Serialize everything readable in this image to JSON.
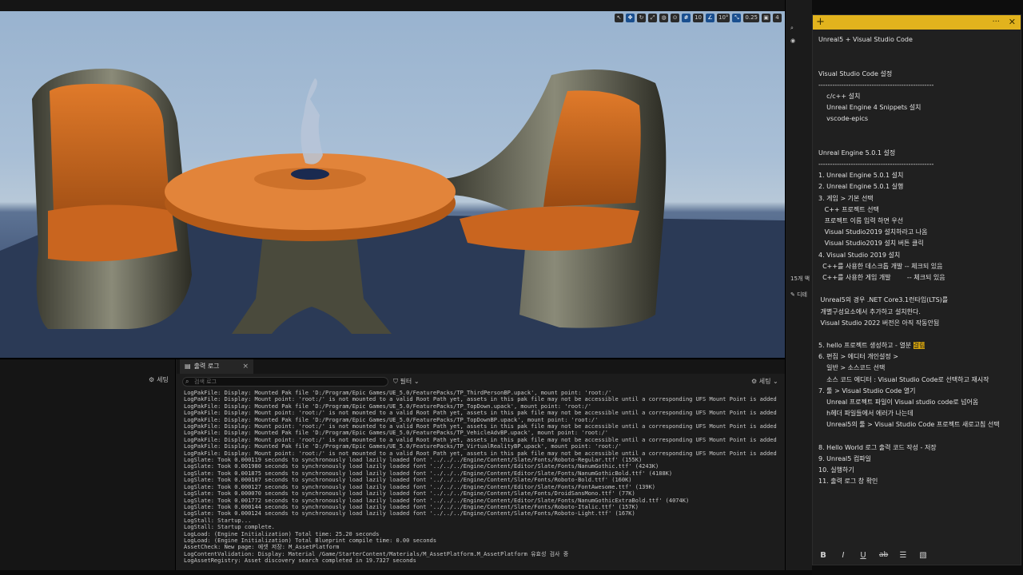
{
  "viewport": {
    "toolbar": [
      "10",
      "10°",
      "0.25",
      "4"
    ]
  },
  "outliner": {
    "count_label": "15개 액",
    "details_label": "디테"
  },
  "log_panel": {
    "left_settings_label": "세팅",
    "tab_label": "출력 로그",
    "search_placeholder": "검색 로그",
    "filter_label": "필터",
    "settings_label": "세팅",
    "lines": [
      "LogPakFile: Display: Mounted Pak file 'D:/Program/Epic Games/UE_5.0/FeaturePacks/TP_ThirdPersonBP.upack', mount point: 'root:/'",
      "LogPakFile: Display: Mount point: 'root:/' is not mounted to a valid Root Path yet, assets in this pak file may not be accessible until a corresponding UFS Mount Point is added t",
      "LogPakFile: Display: Mounted Pak file 'D:/Program/Epic Games/UE_5.0/FeaturePacks/TP_TopDown.upack', mount point: 'root:/'",
      "LogPakFile: Display: Mount point: 'root:/' is not mounted to a valid Root Path yet, assets in this pak file may not be accessible until a corresponding UFS Mount Point is added t",
      "LogPakFile: Display: Mounted Pak file 'D:/Program/Epic Games/UE_5.0/FeaturePacks/TP_TopDownBP.upack', mount point: 'root:/'",
      "LogPakFile: Display: Mount point: 'root:/' is not mounted to a valid Root Path yet, assets in this pak file may not be accessible until a corresponding UFS Mount Point is added t",
      "LogPakFile: Display: Mounted Pak file 'D:/Program/Epic Games/UE_5.0/FeaturePacks/TP_VehicleAdvBP.upack', mount point: 'root:/'",
      "LogPakFile: Display: Mount point: 'root:/' is not mounted to a valid Root Path yet, assets in this pak file may not be accessible until a corresponding UFS Mount Point is added t",
      "LogPakFile: Display: Mounted Pak file 'D:/Program/Epic Games/UE_5.0/FeaturePacks/TP_VirtualRealityBP.upack', mount point: 'root:/'",
      "LogPakFile: Display: Mount point: 'root:/' is not mounted to a valid Root Path yet, assets in this pak file may not be accessible until a corresponding UFS Mount Point is added t",
      "LogSlate: Took 0.000119 seconds to synchronously load lazily loaded font '../../../Engine/Content/Slate/Fonts/Roboto-Regular.ttf' (155K)",
      "LogSlate: Took 0.001980 seconds to synchronously load lazily loaded font '../../../Engine/Content/Editor/Slate/Fonts/NanumGothic.ttf' (4243K)",
      "LogSlate: Took 0.001875 seconds to synchronously load lazily loaded font '../../../Engine/Content/Editor/Slate/Fonts/NanumGothicBold.ttf' (4188K)",
      "LogSlate: Took 0.000107 seconds to synchronously load lazily loaded font '../../../Engine/Content/Slate/Fonts/Roboto-Bold.ttf' (160K)",
      "LogSlate: Took 0.000127 seconds to synchronously load lazily loaded font '../../../Engine/Content/Editor/Slate/Fonts/FontAwesome.ttf' (139K)",
      "LogSlate: Took 0.000070 seconds to synchronously load lazily loaded font '../../../Engine/Content/Slate/Fonts/DroidSansMono.ttf' (77K)",
      "LogSlate: Took 0.001772 seconds to synchronously load lazily loaded font '../../../Engine/Content/Editor/Slate/Fonts/NanumGothicExtraBold.ttf' (4074K)",
      "LogSlate: Took 0.000144 seconds to synchronously load lazily loaded font '../../../Engine/Content/Slate/Fonts/Roboto-Italic.ttf' (157K)",
      "LogSlate: Took 0.000124 seconds to synchronously load lazily loaded font '../../../Engine/Content/Slate/Fonts/Roboto-Light.ttf' (167K)",
      "LogStall: Startup...",
      "LogStall: Startup complete.",
      "LogLoad: (Engine Initialization) Total time: 25.20 seconds",
      "LogLoad: (Engine Initialization) Total Blueprint compile time: 0.00 seconds",
      "AssetCheck: New page: 에셋 저장: M_AssetPlatform",
      "LogContentValidation: Display: Material /Game/StarterContent/Materials/M_AssetPlatform.M_AssetPlatform 유효성 검사 중",
      "LogAssetRegistry: Asset discovery search completed in 19.7327 seconds"
    ]
  },
  "note": {
    "lines": [
      "Unreal5 + Visual Studio Code",
      "",
      "",
      "Visual Studio Code 설정",
      "--------------------------------------------------",
      "    c/c++ 설치",
      "    Unreal Engine 4 Snippets 설치",
      "    vscode-epics",
      "",
      "",
      "Unreal Engine 5.0.1 설정",
      "--------------------------------------------------",
      "1. Unreal Engine 5.0.1 설치",
      "2. Unreal Engine 5.0.1 실행",
      "3. 게임 > 기본 선택",
      "   C++ 프로젝트 선택",
      "   프로젝트 이름 입력 하면 우선",
      "   Visual Studio2019 설치하라고 나옴",
      "   Visual Studio2019 설치 버튼 클릭",
      "4. Visual Studio 2019 설치",
      "  C++를 사용한 데스크톱 개발 -- 체크되 있음",
      "  C++를 사용한 게임 개발        -- 체크되 있음",
      "",
      " Unreal5의 경우 .NET Core3.1런타임(LTS)를",
      " 개별구성요소에서 추가하고 설치한다.",
      " Visual Studio 2022 버전은 아직 작동안됨",
      "",
      "5. hello 프로젝트 생성하고 - 열분 걸림",
      "6. 편집 > 에디터 개인설정 >",
      "    일반 > 소스코드 선택",
      "    소스 코드 에디터 : Visual Studio Code로 선택하고 재시작",
      "7. 툴 > Visual Studio Code 열기",
      "    Unreal 프로젝트 파일이 Visual studio code로 넘어옴",
      "    h헤더 파일들에서 에러가 나는데",
      "    Unreal5의 툴 > Visual Studio Code 프로젝트 새로고침 선택",
      "",
      "8. Hello World 로그 출력 코드 작성 - 저장",
      "9. Unreal5 컴파일",
      "10. 실행하기",
      "11. 출력 로그 창 확인"
    ],
    "highlight": "걸림",
    "format_bold": "B",
    "format_italic": "I",
    "format_underline": "U",
    "format_strike": "ab"
  }
}
